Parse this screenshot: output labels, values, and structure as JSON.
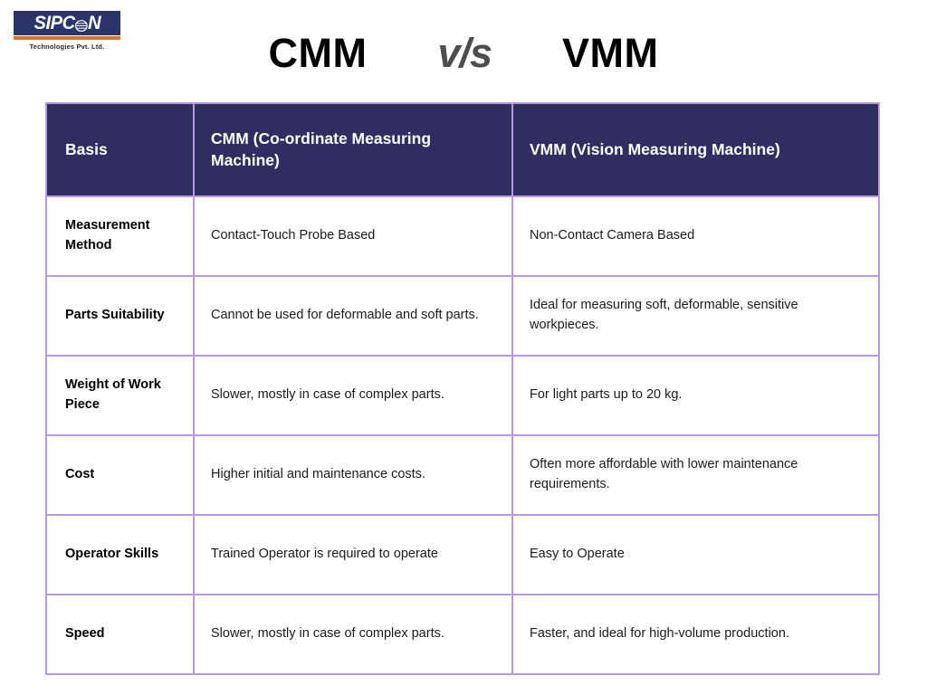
{
  "brand": {
    "name": "SIPCON",
    "name_part1": "SIPC",
    "name_part2": "N",
    "tagline": "Technologies Pvt. Ltd.",
    "badge_color": "#2c3569",
    "bar_color": "#d9772f",
    "globe_icon": "globe-icon"
  },
  "title": {
    "left": "CMM",
    "middle": "v/s",
    "right": "VMM",
    "left_color": "#000000",
    "middle_color": "#4d4d4d",
    "right_color": "#000000"
  },
  "theme": {
    "header_bg": "#302e60",
    "header_text": "#ffffff",
    "border": "#b49be0",
    "body_text": "#1b1b1b"
  },
  "table": {
    "headers": [
      "Basis",
      "CMM (Co-ordinate Measuring Machine)",
      "VMM (Vision Measuring Machine)"
    ],
    "rows": [
      {
        "basis": "Measurement Method",
        "cmm": "Contact-Touch Probe Based",
        "vmm": "Non-Contact Camera Based"
      },
      {
        "basis": "Parts Suitability",
        "cmm": "Cannot be used for deformable and soft parts.",
        "vmm": "Ideal for measuring soft, deformable, sensitive workpieces."
      },
      {
        "basis": "Weight of Work Piece",
        "cmm": "Slower, mostly in case of complex parts.",
        "vmm": "For light parts up to 20 kg."
      },
      {
        "basis": "Cost",
        "cmm": "Higher initial and maintenance costs.",
        "vmm": "Often more affordable with lower maintenance requirements."
      },
      {
        "basis": "Operator Skills",
        "cmm": "Trained Operator is required to operate",
        "vmm": "Easy to Operate"
      },
      {
        "basis": "Speed",
        "cmm": "Slower, mostly in case of complex parts.",
        "vmm": "Faster, and ideal for high-volume production."
      }
    ]
  }
}
